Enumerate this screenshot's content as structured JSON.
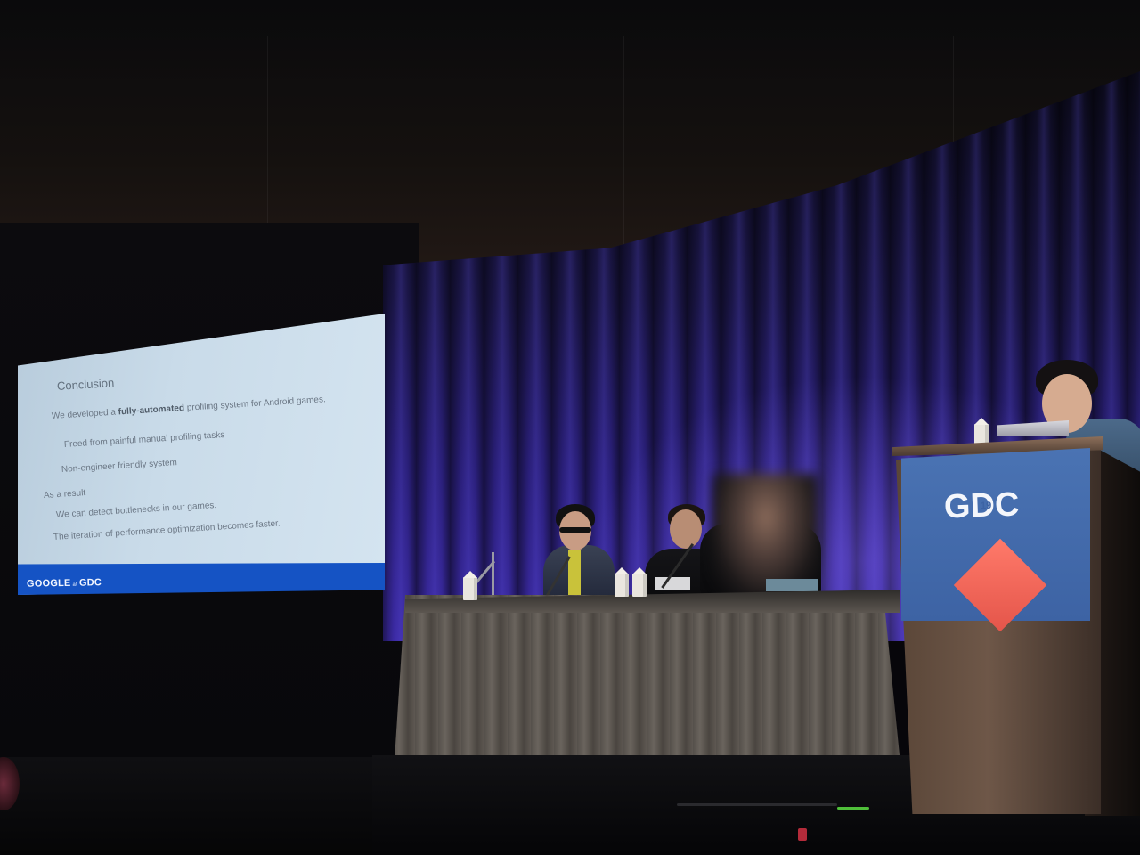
{
  "scene": {
    "description_colors": {
      "curtain": "#2a1f7a",
      "slide_bar": "#1553c4",
      "gdc_panel": "#4a73b3",
      "gdc_diamond": "#ff7a6a"
    }
  },
  "slide": {
    "title": "Conclusion",
    "line1_prefix": "We developed a ",
    "line1_bold": "fully-automated",
    "line1_suffix": " profiling system for Android games.",
    "line2": "Freed from painful manual profiling tasks",
    "line3": "Non-engineer friendly system",
    "line4": "As a result",
    "line5": "We can detect bottlenecks in our games.",
    "line6": "The iteration of performance optimization becomes faster.",
    "footer_brand_left": "GOOGLE",
    "footer_brand_at": "at",
    "footer_brand_right": "GDC"
  },
  "podium": {
    "logo_text": "GDC",
    "logo_year": "19"
  }
}
